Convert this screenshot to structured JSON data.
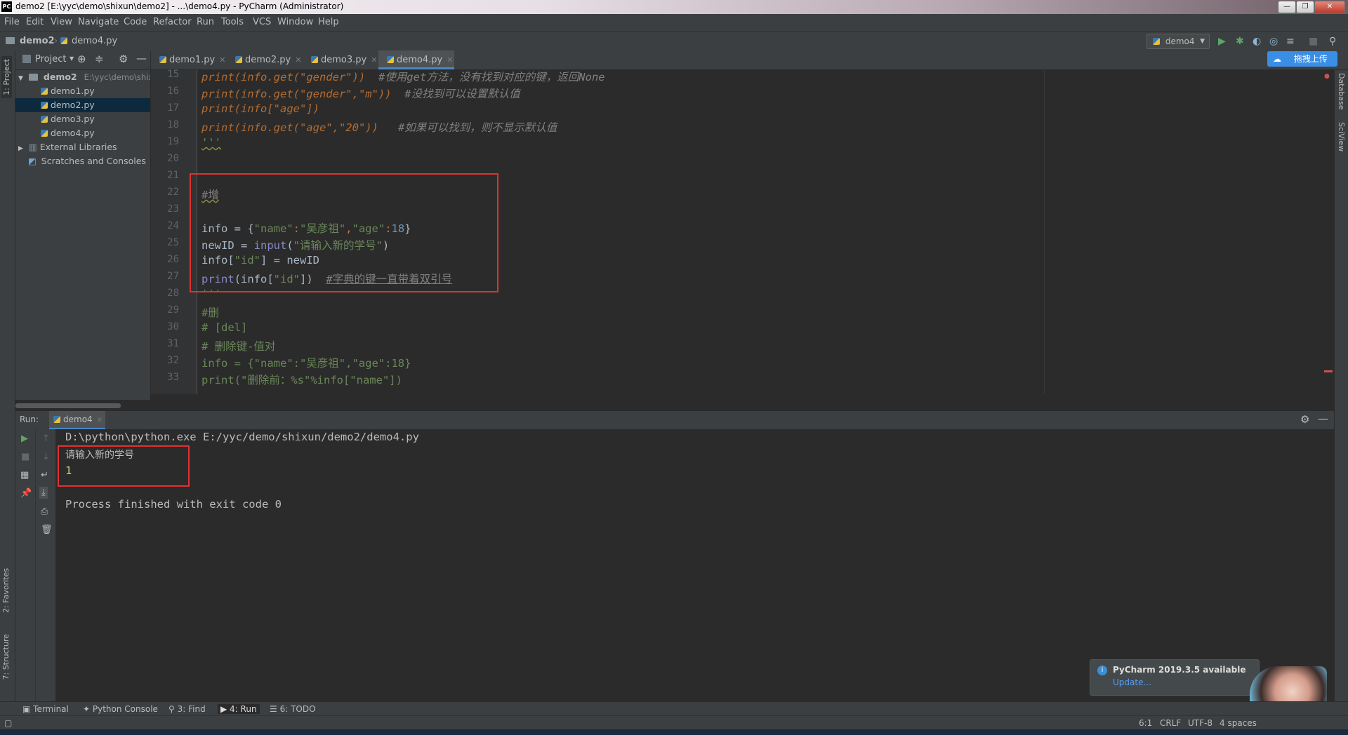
{
  "window": {
    "title": "demo2 [E:\\yyc\\demo\\shixun\\demo2] - ...\\demo4.py - PyCharm (Administrator)",
    "logo": "PC",
    "controls": [
      "—",
      "❐",
      "✕"
    ]
  },
  "menu": [
    "File",
    "Edit",
    "View",
    "Navigate",
    "Code",
    "Refactor",
    "Run",
    "Tools",
    "VCS",
    "Window",
    "Help"
  ],
  "breadcrumb": {
    "project": "demo2",
    "file": "demo4.py"
  },
  "run_config": "demo4",
  "upload_button": "拖拽上传",
  "project_panel": {
    "header": "Project",
    "root": {
      "name": "demo2",
      "path": "E:\\yyc\\demo\\shixu"
    },
    "files": [
      "demo1.py",
      "demo2.py",
      "demo3.py",
      "demo4.py"
    ],
    "selected": "demo2.py",
    "external": "External Libraries",
    "scratches": "Scratches and Consoles"
  },
  "left_tabs": {
    "project": "1: Project",
    "favorites": "2: Favorites",
    "structure": "7: Structure"
  },
  "right_tabs": {
    "database": "Database",
    "sciview": "SciView"
  },
  "editor_tabs": [
    "demo1.py",
    "demo2.py",
    "demo3.py",
    "demo4.py"
  ],
  "active_tab": "demo4.py",
  "code": {
    "line_numbers": [
      "15",
      "16",
      "17",
      "18",
      "19",
      "20",
      "21",
      "22",
      "23",
      "24",
      "25",
      "26",
      "27",
      "28",
      "29",
      "30",
      "31",
      "32",
      "33"
    ],
    "l15_a": "print(info.get(\"gender\"))",
    "l15_c": "#使用get方法，没有找到对应的键，返回None",
    "l16_a": "print(info.get(\"gender\",\"m\"))",
    "l16_c": "#没找到可以设置默认值",
    "l17": "print(info[\"age\"])",
    "l18_a": "print(info.get(\"age\",\"20\"))",
    "l18_c": "#如果可以找到，则不显示默认值",
    "l19": "'''",
    "l22": "#增",
    "l24_a": "info = {",
    "l24_k1": "\"name\"",
    "l24_v1": "\"吴彦祖\"",
    "l24_k2": "\"age\"",
    "l24_n": "18",
    "l25_a": "newID = ",
    "l25_fn": "input",
    "l25_s": "\"请输入新的学号\"",
    "l26_a": "info[",
    "l26_s": "\"id\"",
    "l26_b": "] = newID",
    "l27_fn": "print",
    "l27_a": "(info[",
    "l27_s": "\"id\"",
    "l27_b": "])",
    "l27_c": "#字典的键一直带着双引号",
    "l28": "'''",
    "l29": "#删",
    "l30": "# [del]",
    "l31": "# 删除键-值对",
    "l32": "info = {\"name\":\"吴彦祖\",\"age\":18}",
    "l33": "print(\"删除前：%s\"%info[\"name\"])"
  },
  "run_panel": {
    "label": "Run:",
    "tab": "demo4",
    "lines": [
      "D:\\python\\python.exe E:/yyc/demo/shixun/demo2/demo4.py",
      "请输入新的学号",
      "1",
      "",
      "Process finished with exit code 0"
    ]
  },
  "bottom_tabs": [
    "Terminal",
    "Python Console",
    "3: Find",
    "4: Run",
    "6: TODO"
  ],
  "notification": {
    "title": "PyCharm 2019.3.5 available",
    "link": "Update..."
  },
  "status": {
    "position": "6:1",
    "line_sep": "CRLF",
    "encoding": "UTF-8",
    "indent": "4 spaces"
  }
}
